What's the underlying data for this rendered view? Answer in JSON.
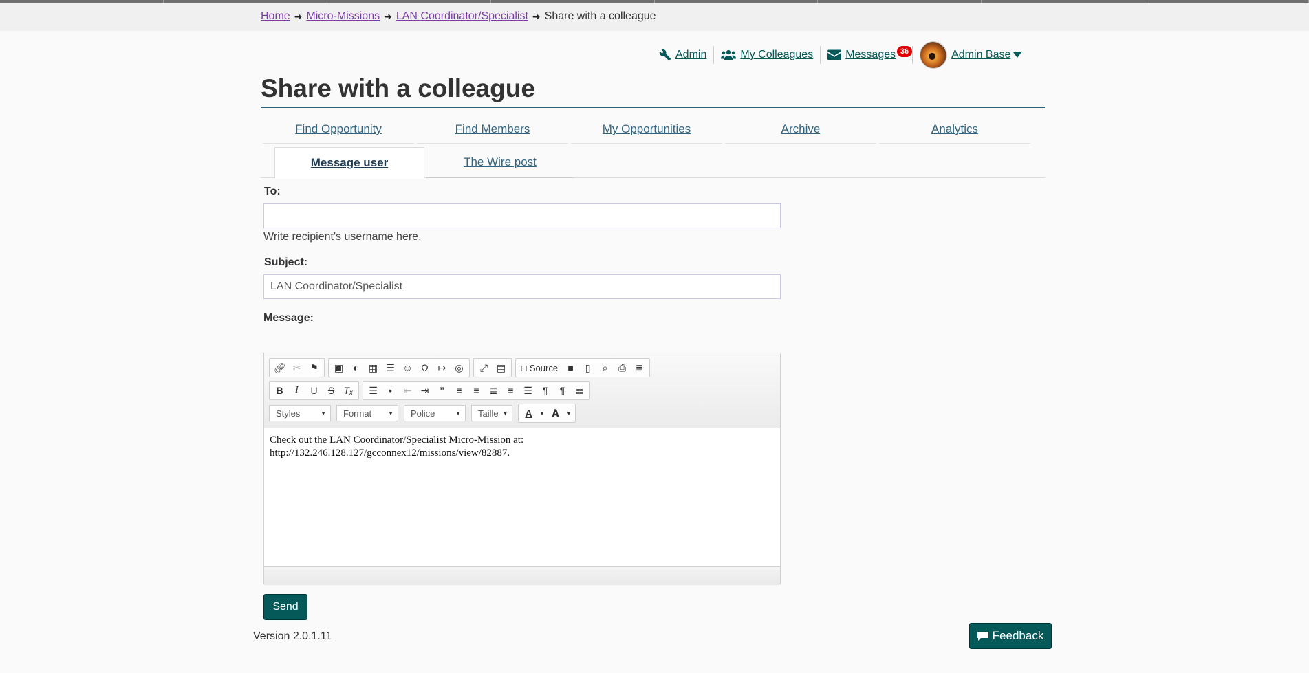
{
  "breadcrumb": {
    "items": [
      "Home",
      "Micro-Missions",
      "LAN Coordinator/Specialist"
    ],
    "current": "Share with a colleague"
  },
  "usermenu": {
    "admin": "Admin",
    "colleagues": "My Colleagues",
    "messages": "Messages",
    "messages_count": "36",
    "user": "Admin Base"
  },
  "page": {
    "title": "Share with a colleague"
  },
  "nav": {
    "tabs": [
      "Find Opportunity",
      "Find Members",
      "My Opportunities",
      "Archive",
      "Analytics"
    ]
  },
  "subtabs": {
    "active": "Message user",
    "other": "The Wire post"
  },
  "form": {
    "to_label": "To:",
    "to_value": "",
    "to_help": "Write recipient's username here.",
    "subject_label": "Subject:",
    "subject_value": "LAN Coordinator/Specialist",
    "message_label": "Message:",
    "message_line1": "Check out the LAN Coordinator/Specialist Micro-Mission at:",
    "message_line2": "http://132.246.128.127/gcconnex12/missions/view/82887.",
    "send_label": "Send"
  },
  "editor": {
    "source_label": "Source",
    "combos": [
      "Styles",
      "Format",
      "Police",
      "Taille"
    ]
  },
  "footer": {
    "version": "Version 2.0.1.11",
    "feedback": "Feedback"
  },
  "colors": {
    "accent": "#055959",
    "link_visited": "#7b3ea7",
    "badge": "#dd0000"
  }
}
